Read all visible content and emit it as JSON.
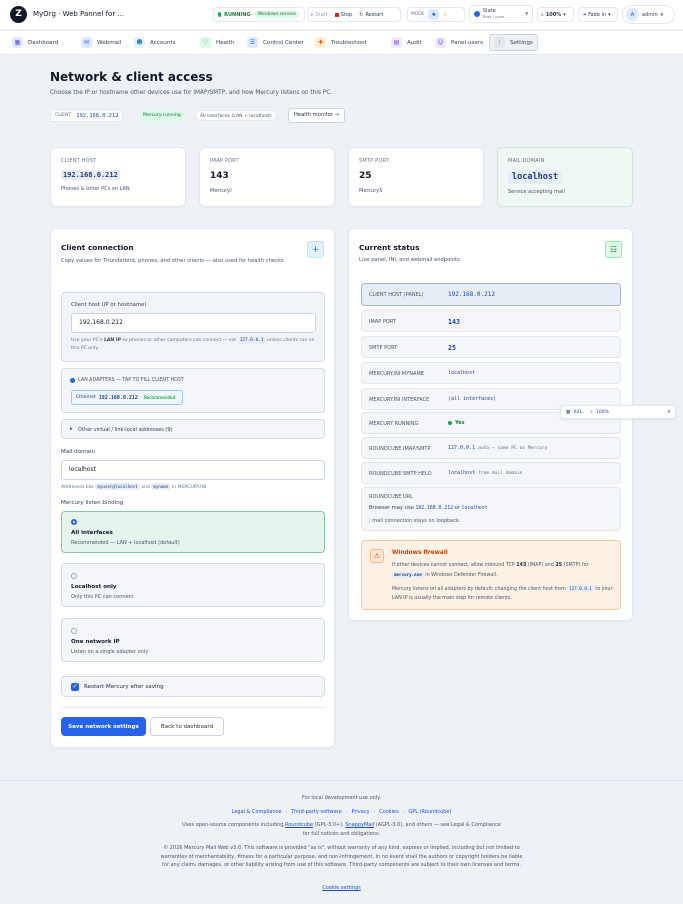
{
  "header": {
    "logo": "Z",
    "title": "MyOrg · Web Pannel for ...",
    "status": "RUNNING",
    "service_badge": "Windows service",
    "start": "Start",
    "stop": "Stop",
    "restart": "Restart",
    "mode_label": "MODE",
    "theme_name": "Slate",
    "theme_sub": "Blue / cyan",
    "zoom": "100%",
    "fade": "Fade in",
    "user_initial": "A",
    "user": "admin"
  },
  "nav": {
    "items": [
      "Dashboard",
      "Webmail",
      "Accounts",
      "Health",
      "Control Center",
      "Troubleshoot",
      "Audit",
      "Panel users",
      "Settings"
    ]
  },
  "page": {
    "title": "Network & client access",
    "subtitle": "Choose the IP or hostname other devices use for IMAP/SMTP, and how Mercury listens on this PC.",
    "client_label": "CLIENT",
    "client_value": "192.168.0.212",
    "running_badge": "Mercury running",
    "interfaces_badge": "All interfaces (LAN + localhost)",
    "health_button": "Health monitor →"
  },
  "stats": [
    {
      "label": "CLIENT HOST",
      "value": "192.168.0.212",
      "sub": "Phones & other PCs on LAN"
    },
    {
      "label": "IMAP PORT",
      "value": "143",
      "sub": "MercuryI"
    },
    {
      "label": "SMTP PORT",
      "value": "25",
      "sub": "MercuryS"
    },
    {
      "label": "MAIL DOMAIN",
      "value": "localhost",
      "sub": "Service accepting mail"
    }
  ],
  "client": {
    "title": "Client connection",
    "subtitle": "Copy values for Thunderbird, phones, and other clients — also used for health checks",
    "host_label": "Client host (IP or hostname)",
    "host_value": "192.168.0.212",
    "hint_a": "Use your PC's ",
    "hint_b": "LAN IP",
    "hint_c": " so phones or other computers can connect — not ",
    "hint_code": "127.0.0.1",
    "hint_d": " unless clients run on this PC only.",
    "lan_title": "LAN ADAPTERS — TAP TO FILL CLIENT HOST",
    "adapter_name": "Ethernet",
    "adapter_ip": "192.168.0.212",
    "adapter_badge": "Recommended",
    "other_addresses": "Other virtual / link-local addresses (9)",
    "domain_label": "Mail domain",
    "domain_value": "localhost",
    "domain_hint_a": "Addresses like ",
    "domain_hint_code1": "myuser@localhost",
    "domain_hint_b": " and ",
    "domain_hint_code2": "myname",
    "domain_hint_c": " in MERCURY.INI",
    "binding_label": "Mercury listen binding",
    "options": [
      {
        "title": "All interfaces",
        "desc": "Recommended — LAN + localhost (default)"
      },
      {
        "title": "Localhost only",
        "desc": "Only this PC can connect"
      },
      {
        "title": "One network IP",
        "desc": "Listen on a single adapter only"
      }
    ],
    "restart_label": "Restart Mercury after saving",
    "save_button": "Save network settings",
    "back_button": "Back to dashboard"
  },
  "status": {
    "title": "Current status",
    "subtitle": "Live panel, INI, and webmail endpoints",
    "rows": [
      {
        "key": "CLIENT HOST (PANEL)",
        "value": "192.168.0.212"
      },
      {
        "key": "IMAP PORT",
        "value": "143"
      },
      {
        "key": "SMTP PORT",
        "value": "25"
      },
      {
        "key": "MERCURY.INI MYNAME",
        "value": "localhost"
      },
      {
        "key": "MERCURY.INI INTERFACE",
        "value": "(all interfaces)"
      },
      {
        "key": "MERCURY RUNNING",
        "value": "Yes"
      },
      {
        "key": "ROUNDCUBE IMAP/SMTP",
        "value": "127.0.0.1",
        "extra": "auto — same PC as Mercury"
      },
      {
        "key": "ROUNDCUBE SMTP HELO",
        "value": "localhost",
        "extra": "from mail domain"
      }
    ],
    "url_key": "ROUNDCUBE URL",
    "url_a": "Browser may use ",
    "url_code1": "192.168.0.212",
    "url_b": " or ",
    "url_code2": "localhost",
    "url_c": "; mail connection stays on loopback.",
    "fw_title": "Windows firewall",
    "fw_p1a": "If other devices cannot connect, allow inbound TCP ",
    "fw_p1b": "143",
    "fw_p1c": " (IMAP) and ",
    "fw_p1d": "25",
    "fw_p1e": " (SMTP) for ",
    "fw_code": "mercury.exe",
    "fw_p1f": " in Windows Defender Firewall.",
    "fw_p2a": "Mercury listens on all adapters by default; changing the client host from ",
    "fw_p2code": "127.0.0.1",
    "fw_p2b": " to your LAN IP is usually the main step for remote clients."
  },
  "float": {
    "size": "XXL",
    "zoom": "100%"
  },
  "footer": {
    "line1": "For local development use only.",
    "links": [
      "Legal & Compliance",
      "Third-party software",
      "Privacy",
      "Cookies",
      "GPL (Roundcube)"
    ],
    "oss_a": "Uses open-source components including ",
    "oss_rc": "Roundcube",
    "oss_b": " (GPL-3.0+), ",
    "oss_sm": "SnappyMail",
    "oss_c": " (AGPL-3.0), and others — see Legal & Compliance for full notices and obligations.",
    "copyright": "© 2026 Mercury Mail Web v3.0. This software is provided \"as is\", without warranty of any kind, express or implied, including but not limited to warranties of merchantability, fitness for a particular purpose, and non-infringement. In no event shall the authors or copyright holders be liable for any claim, damages, or other liability arising from use of this software. Third-party components are subject to their own licenses and terms.",
    "cookie_settings": "Cookie settings"
  },
  "colors": {
    "primary": "#2563eb",
    "green": "#16a34a",
    "warn": "#c2410c",
    "bg": "#eef2f6"
  }
}
